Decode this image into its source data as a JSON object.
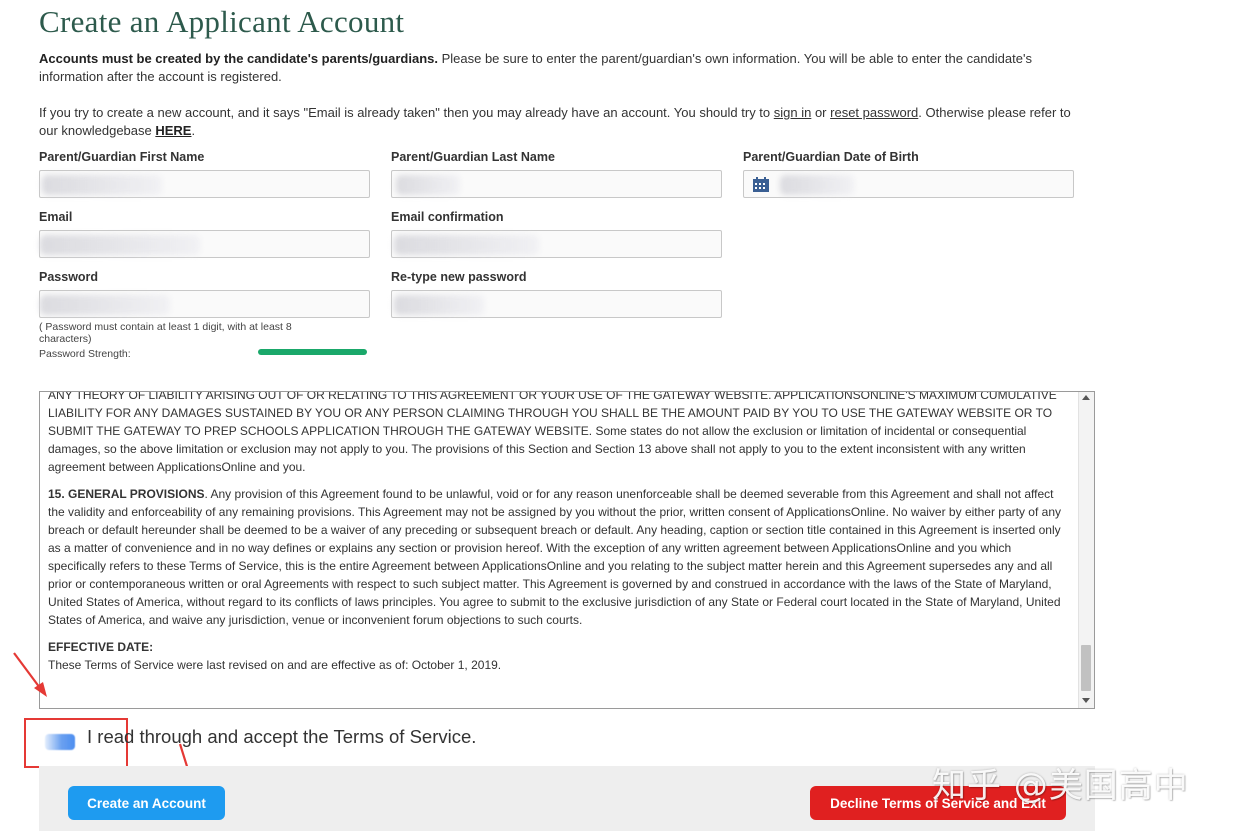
{
  "page": {
    "title": "Create an Applicant Account"
  },
  "intro": {
    "bold": "Accounts must be created by the candidate's parents/guardians.",
    "text": " Please be sure to enter the parent/guardian's own information. You will be able to enter the candidate's information after the account is registered.",
    "line2_a": "If you try to create a new account, and it says \"Email is already taken\" then you may already have an account. You should try to ",
    "sign_in": "sign in",
    "or": " or ",
    "reset_password": "reset password",
    "line2_b": ". Otherwise please refer to our knowledgebase ",
    "here": "HERE",
    "period": "."
  },
  "form": {
    "first_name_label": "Parent/Guardian First Name",
    "last_name_label": "Parent/Guardian Last Name",
    "dob_label": "Parent/Guardian Date of Birth",
    "email_label": "Email",
    "email_confirm_label": "Email confirmation",
    "password_label": "Password",
    "retype_label": "Re-type new password",
    "password_hint": "( Password must contain at least 1 digit, with at least 8 characters)",
    "password_strength_label": "Password Strength:",
    "password_strength": 1.0
  },
  "tos": {
    "p1": "ANY THEORY OF LIABILITY ARISING OUT OF OR RELATING TO THIS AGREEMENT OR YOUR USE OF THE GATEWAY WEBSITE. APPLICATIONSONLINE'S MAXIMUM CUMULATIVE LIABILITY FOR ANY DAMAGES SUSTAINED BY YOU OR ANY PERSON CLAIMING THROUGH YOU SHALL BE THE AMOUNT PAID BY YOU TO USE THE GATEWAY WEBSITE OR TO SUBMIT THE GATEWAY TO PREP SCHOOLS APPLICATION THROUGH THE GATEWAY WEBSITE. Some states do not allow the exclusion or limitation of incidental or consequential damages, so the above limitation or exclusion may not apply to you. The provisions of this Section and Section 13 above shall not apply to you to the extent inconsistent with any written agreement between ApplicationsOnline and you.",
    "s15_heading": "15. GENERAL PROVISIONS",
    "s15_text": ". Any provision of this Agreement found to be unlawful, void or for any reason unenforceable shall be deemed severable from this Agreement and shall not affect the validity and enforceability of any remaining provisions. This Agreement may not be assigned by you without the prior, written consent of ApplicationsOnline. No waiver by either party of any breach or default hereunder shall be deemed to be a waiver of any preceding or subsequent breach or default. Any heading, caption or section title contained in this Agreement is inserted only as a matter of convenience and in no way defines or explains any section or provision hereof. With the exception of any written agreement between ApplicationsOnline and you which specifically refers to these Terms of Service, this is the entire Agreement between ApplicationsOnline and you relating to the subject matter herein and this Agreement supersedes any and all prior or contemporaneous written or oral Agreements with respect to such subject matter. This Agreement is governed by and construed in accordance with the laws of the State of Maryland, United States of America, without regard to its conflicts of laws principles. You agree to submit to the exclusive jurisdiction of any State or Federal court located in the State of Maryland, United States of America, and waive any jurisdiction, venue or inconvenient forum objections to such courts.",
    "effective_heading": "EFFECTIVE DATE:",
    "effective_text": "These Terms of Service were last revised on and are effective as of: October 1, 2019."
  },
  "accept": {
    "label": "I read through and accept the Terms of Service."
  },
  "buttons": {
    "create": "Create an Account",
    "decline": "Decline Terms of Service and Exit"
  },
  "watermark": "知乎 @美国高中",
  "colors": {
    "title": "#2d5a4c",
    "primary": "#1e9bf0",
    "danger": "#e02020",
    "strength": "#1aa86a",
    "annotation": "#e53935"
  },
  "icons": {
    "calendar": "calendar-icon"
  }
}
